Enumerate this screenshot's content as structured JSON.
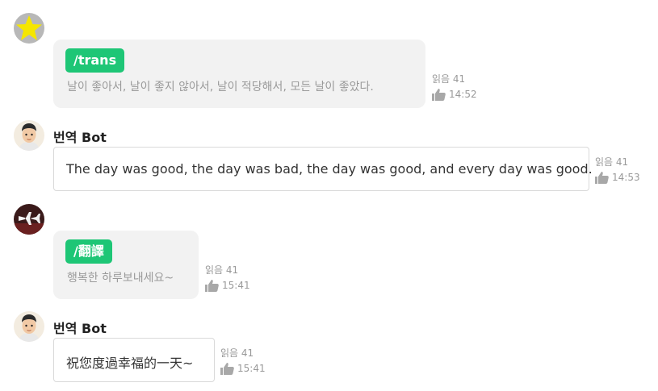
{
  "messages": [
    {
      "sender": "",
      "command": "/trans",
      "text": "날이 좋아서, 날이 좋지 않아서, 날이 적당해서, 모든 날이 좋았다.",
      "read": "읽음 41",
      "time": "14:52",
      "avatar_icon": "star-avatar"
    },
    {
      "sender": "번역 Bot",
      "text": "The day was good, the day was bad, the day was good, and every day was good.",
      "read": "읽음 41",
      "time": "14:53",
      "avatar_icon": "bot-avatar"
    },
    {
      "sender": "",
      "command": "/翻譯",
      "text": "행복한 하루보내세요~",
      "read": "읽음 41",
      "time": "15:41",
      "avatar_icon": "airplane-avatar"
    },
    {
      "sender": "번역 Bot",
      "text": "祝您度過幸福的一天~",
      "read": "읽음 41",
      "time": "15:41",
      "avatar_icon": "bot-avatar"
    }
  ],
  "colors": {
    "command_tag": "#1ec676",
    "user_bubble": "#f2f2f2",
    "bot_bubble_border": "#d9d9d9",
    "meta_text": "#999999"
  },
  "icons": {
    "like": "thumbs-up-icon"
  }
}
